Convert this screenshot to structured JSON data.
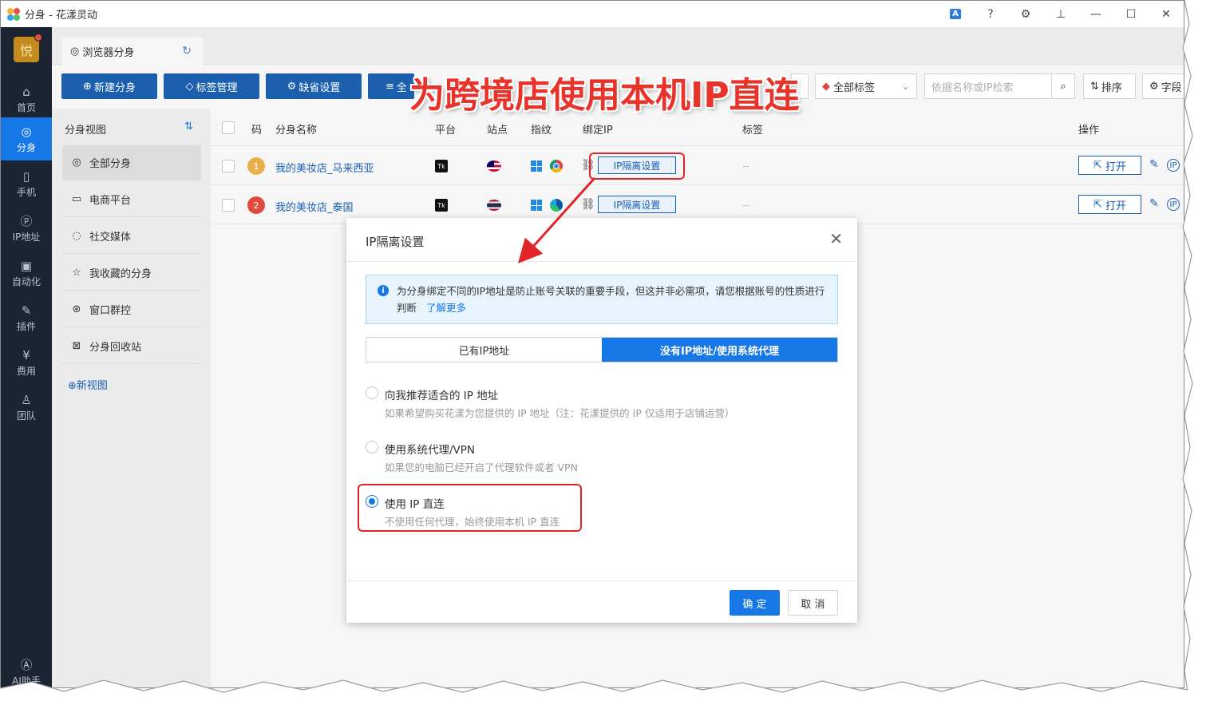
{
  "window": {
    "title": "分身 - 花漾灵动"
  },
  "nav": {
    "avatar": "悦",
    "items": [
      {
        "label": "首页",
        "icon": "home-icon"
      },
      {
        "label": "分身",
        "icon": "chrome-icon"
      },
      {
        "label": "手机",
        "icon": "phone-icon"
      },
      {
        "label": "IP地址",
        "icon": "ip-icon"
      },
      {
        "label": "自动化",
        "icon": "robot-icon"
      },
      {
        "label": "插件",
        "icon": "puzzle-icon"
      },
      {
        "label": "费用",
        "icon": "yen-icon"
      },
      {
        "label": "团队",
        "icon": "team-icon"
      }
    ],
    "ai": "AI助手"
  },
  "tab": {
    "label": "浏览器分身"
  },
  "toolbar": {
    "new": "新建分身",
    "tags": "标签管理",
    "defaults": "缺省设置",
    "all_prefix": "全",
    "all_tags": "全部标签",
    "search_placeholder": "依据名称或IP检索",
    "sort": "排序",
    "fields": "字段"
  },
  "views": {
    "title": "分身视图",
    "items": [
      "全部分身",
      "电商平台",
      "社交媒体",
      "我收藏的分身",
      "窗口群控",
      "分身回收站"
    ],
    "new_view": "新视图"
  },
  "table": {
    "headers": [
      "码",
      "分身名称",
      "平台",
      "站点",
      "指纹",
      "绑定IP",
      "标签",
      "操作"
    ],
    "rows": [
      {
        "code": "1",
        "name": "我的美妆店_马来西亚",
        "platform": "Tk",
        "ip_button": "IP隔离设置",
        "tag": "--",
        "open": "打开"
      },
      {
        "code": "2",
        "name": "我的美妆店_泰国",
        "platform": "Tk",
        "ip_button": "IP隔离设置",
        "tag": "--",
        "open": "打开"
      }
    ],
    "ip_badge": "IP"
  },
  "dialog": {
    "title": "IP隔离设置",
    "notice": "为分身绑定不同的IP地址是防止账号关联的重要手段，但这并非必需项，请您根据账号的性质进行判断",
    "learn_more": "了解更多",
    "segments": [
      "已有IP地址",
      "没有IP地址/使用系统代理"
    ],
    "options": [
      {
        "title": "向我推荐适合的 IP 地址",
        "desc": "如果希望购买花漾为您提供的 IP 地址（注：花漾提供的 IP 仅适用于店铺运营）",
        "checked": false
      },
      {
        "title": "使用系统代理/VPN",
        "desc": "如果您的电脑已经开启了代理软件或者 VPN",
        "checked": false
      },
      {
        "title": "使用 IP 直连",
        "desc": "不使用任何代理，始终使用本机 IP 直连",
        "checked": true
      }
    ],
    "ok": "确 定",
    "cancel": "取 消"
  },
  "annotation": {
    "headline": "为跨境店使用本机IP直连"
  }
}
